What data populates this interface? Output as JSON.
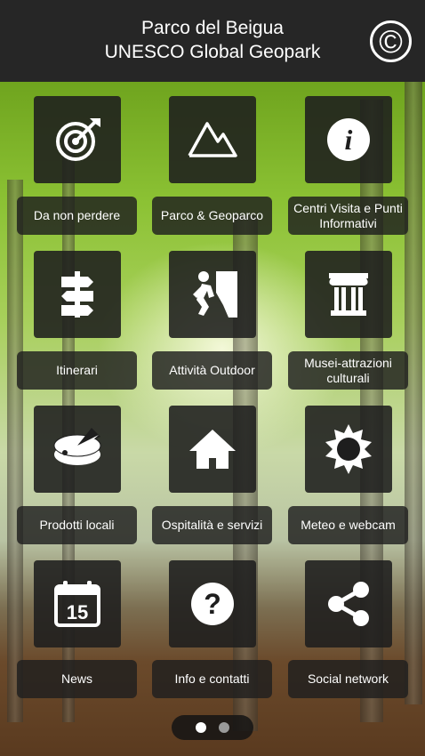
{
  "header": {
    "title_line1": "Parco del Beigua",
    "title_line2": "UNESCO Global Geopark",
    "copyright_symbol": "©"
  },
  "grid": [
    {
      "label": "Da non perdere",
      "icon": "target-icon"
    },
    {
      "label": "Parco & Geoparco",
      "icon": "mountain-icon"
    },
    {
      "label": "Centri Visita e Punti Informativi",
      "icon": "info-icon"
    },
    {
      "label": "Itinerari",
      "icon": "signpost-icon"
    },
    {
      "label": "Attività Outdoor",
      "icon": "climber-icon"
    },
    {
      "label": "Musei-attrazioni culturali",
      "icon": "column-icon"
    },
    {
      "label": "Prodotti locali",
      "icon": "cheese-icon"
    },
    {
      "label": "Ospitalità e servizi",
      "icon": "home-icon"
    },
    {
      "label": "Meteo e webcam",
      "icon": "sun-icon"
    },
    {
      "label": "News",
      "icon": "calendar-icon"
    },
    {
      "label": "Info e contatti",
      "icon": "question-icon"
    },
    {
      "label": "Social network",
      "icon": "share-icon"
    }
  ],
  "calendar_day": "15",
  "pager": {
    "pages": 2,
    "current": 1
  },
  "colors": {
    "header_bg": "#262626",
    "tile_bg": "#1e1e1e",
    "text": "#ffffff"
  }
}
